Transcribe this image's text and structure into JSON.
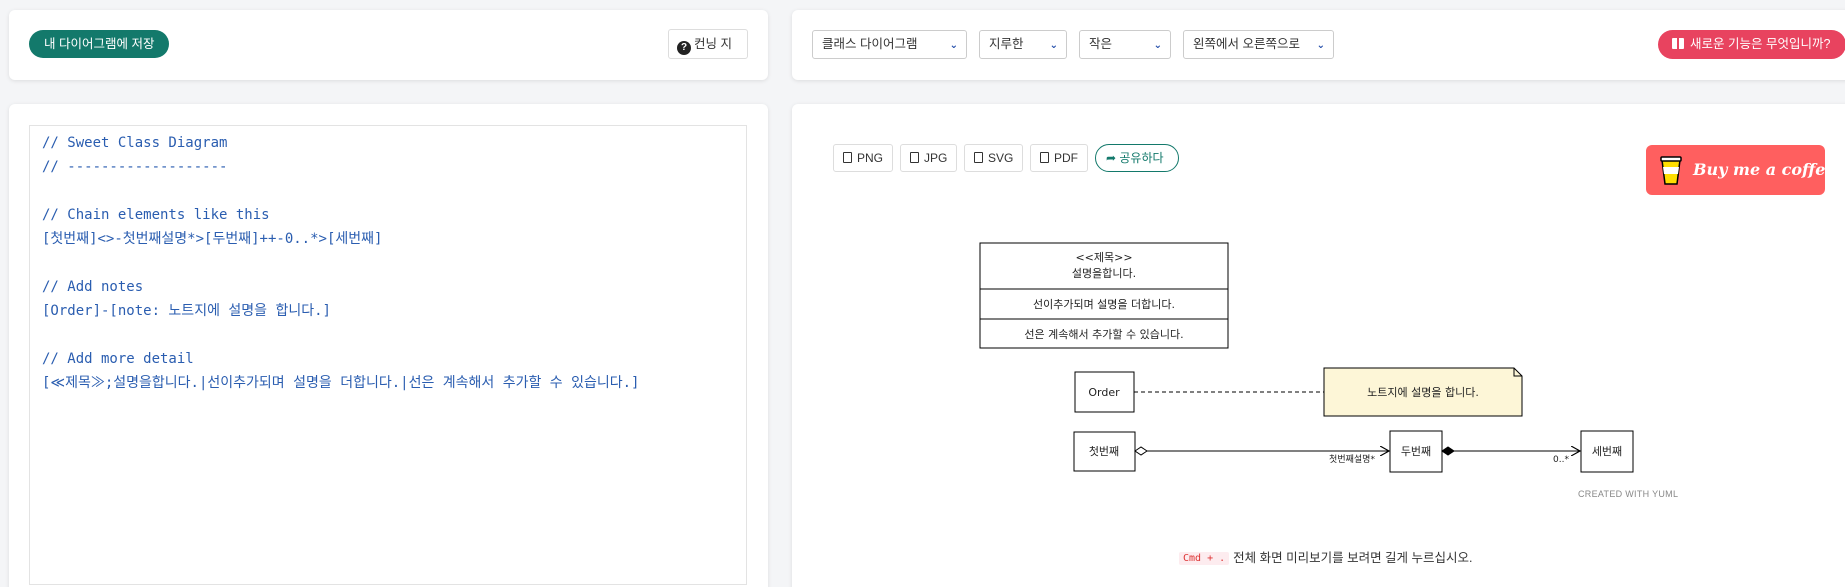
{
  "toolbar": {
    "save_label": "내 다이어그램에 저장",
    "help_label": "컨닝 지",
    "diagram_type": "클래스 다이어그램",
    "style": "지루한",
    "size": "작은",
    "direction": "왼쪽에서 오른쪽으로",
    "whats_new_label": "새로운 기능은 무엇입니까?"
  },
  "editor": {
    "code": "// Sweet Class Diagram\n// -------------------\n\n// Chain elements like this\n[첫번째]<>-첫번째설명*>[두번째]++-0..*>[세번째]\n\n// Add notes\n[Order]-[note: 노트지에 설명을 합니다.]\n\n// Add more detail\n[≪제목≫;설명을합니다.|선이추가되며 설명을 더합니다.|선은 계속해서 추가할 수 있습니다.]"
  },
  "export": {
    "png": "PNG",
    "jpg": "JPG",
    "svg": "SVG",
    "pdf": "PDF",
    "share": "공유하다"
  },
  "coffee_label": "Buy me a coffee",
  "diagram": {
    "class_box": {
      "title": "<<제목>>",
      "desc": "설명을합니다.",
      "line2": "선이추가되며 설명을 더합니다.",
      "line3": "선은 계속해서 추가할 수 있습니다."
    },
    "order": "Order",
    "note": "노트지에 설명을 합니다.",
    "first": "첫번째",
    "second": "두번째",
    "third": "세번째",
    "assoc_label": "첫번째설명*",
    "multiplicity": "0..*",
    "watermark": "CREATED WITH YUML"
  },
  "hint": {
    "key": "Cmd + .",
    "text": "전체 화면 미리보기를 보려면 길게 누르십시오."
  },
  "colors": {
    "primary": "#13796b",
    "accent": "#e8435f",
    "coffee": "#ff5f5f",
    "note_fill": "#fdf6d7",
    "code_text": "#2a5db0"
  }
}
